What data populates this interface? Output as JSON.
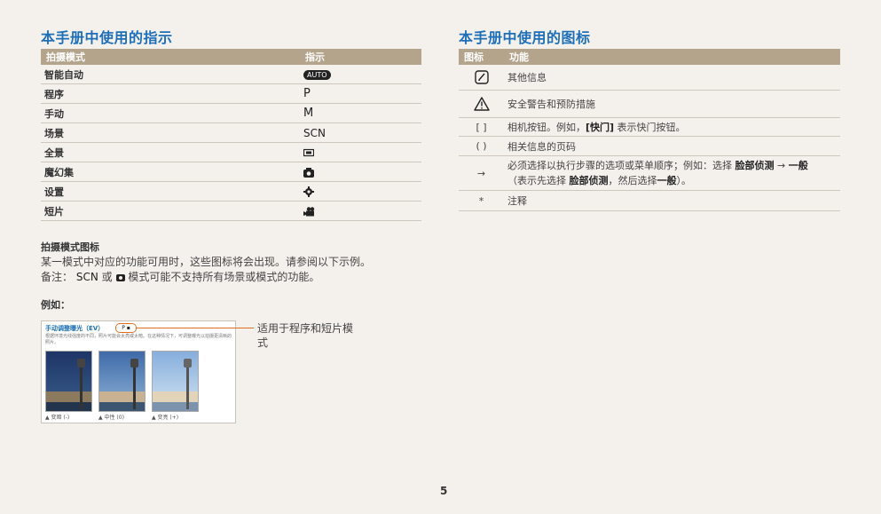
{
  "left": {
    "heading": "本手册中使用的指示",
    "table_headers": [
      "拍摄模式",
      "指示"
    ],
    "rows": [
      {
        "mode": "智能自动",
        "indicator": "AUTO"
      },
      {
        "mode": "程序",
        "indicator": "P"
      },
      {
        "mode": "手动",
        "indicator": "M"
      },
      {
        "mode": "场景",
        "indicator": "SCN"
      },
      {
        "mode": "全景",
        "indicator": "panorama-icon"
      },
      {
        "mode": "魔幻集",
        "indicator": "magic-icon"
      },
      {
        "mode": "设置",
        "indicator": "settings-icon"
      },
      {
        "mode": "短片",
        "indicator": "movie-icon"
      }
    ],
    "mode_icons_heading": "拍摄模式图标",
    "mode_icons_text": "某一模式中对应的功能可用时，这些图标将会出现。请参阅以下示例。",
    "note_prefix": "备注：",
    "note_scn": "SCN",
    "note_or": "或",
    "note_suffix": "模式可能不支持所有场景或模式的功能。",
    "example_heading": "例如：",
    "sample": {
      "title": "手动调整曝光（EV）",
      "badge": "P",
      "desc": "根据环境光线强度的不同，照片可能会太亮或太暗。在这种情况下，可调整曝光以拍摄更清晰的照片。",
      "captions": [
        "▲ 变暗 (-)",
        "▲ 中性 (0)",
        "▲ 变亮 (+)"
      ]
    },
    "callout": "适用于程序和短片模式"
  },
  "right": {
    "heading": "本手册中使用的图标",
    "table_headers": [
      "图标",
      "功能"
    ],
    "rows": [
      {
        "icon": "memo-icon",
        "text": "其他信息"
      },
      {
        "icon": "warning-icon",
        "text": "安全警告和预防措施"
      },
      {
        "icon": "[ ]",
        "text_a": "相机按钮。例如，",
        "text_b": "[快门]",
        "text_c": " 表示快门按钮。"
      },
      {
        "icon": "( )",
        "text": "相关信息的页码"
      },
      {
        "icon": "→",
        "line1_a": "必须选择以执行步骤的选项或菜单顺序；例如：选择 ",
        "line1_b": "脸部侦测",
        "line1_c": " → ",
        "line1_d": "一般",
        "line2_a": "（表示先选择 ",
        "line2_b": "脸部侦测",
        "line2_c": "，然后选择",
        "line2_d": "一般",
        "line2_e": "）。"
      },
      {
        "icon": "*",
        "text": "注释"
      }
    ]
  },
  "page_number": "5",
  "colors": {
    "heading": "#1e6fb8",
    "table_header": "#b5a48c",
    "accent": "#e07020",
    "background": "#f4f1ec"
  }
}
